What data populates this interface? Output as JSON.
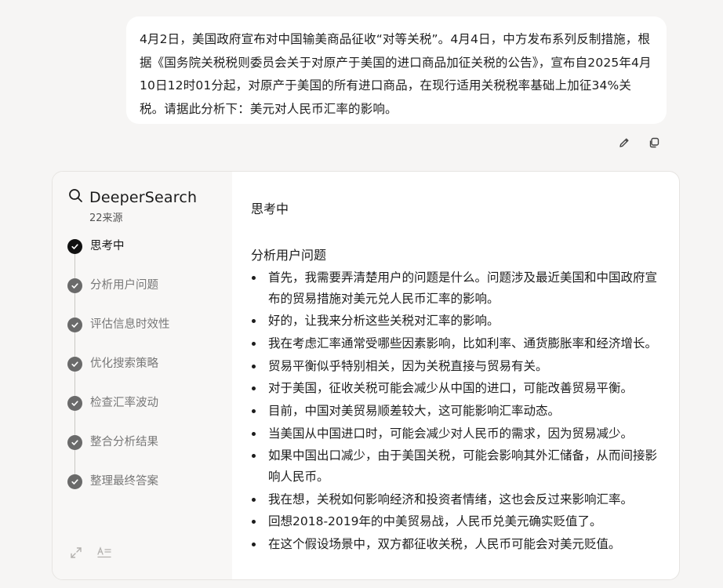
{
  "user_message": {
    "text": "4月2日，美国政府宣布对中国输美商品征收“对等关税”。4月4日，中方发布系列反制措施，根据《国务院关税税则委员会关于对原产于美国的进口商品加征关税的公告》，宣布自2025年4月10日12时01分起，对原产于美国的所有进口商品，在现行适用关税税率基础上加征34%关税。请据此分析下：美元对人民币汇率的影响。"
  },
  "message_actions": {
    "edit_icon": "pencil-icon",
    "copy_icon": "copy-icon"
  },
  "deepersearch": {
    "title": "DeeperSearch",
    "sources": "22来源",
    "steps": [
      {
        "label": "思考中",
        "status": "active"
      },
      {
        "label": "分析用户问题",
        "status": "done"
      },
      {
        "label": "评估信息时效性",
        "status": "done"
      },
      {
        "label": "优化搜索策略",
        "status": "done"
      },
      {
        "label": "检查汇率波动",
        "status": "done"
      },
      {
        "label": "整合分析结果",
        "status": "done"
      },
      {
        "label": "整理最终答案",
        "status": "done"
      }
    ],
    "tools": {
      "expand_icon": "expand-icon",
      "format_icon": "text-format-icon"
    }
  },
  "content": {
    "thinking_title": "思考中",
    "section_title": "分析用户问题",
    "bullets": [
      "首先，我需要弄清楚用户的问题是什么。问题涉及最近美国和中国政府宣布的贸易措施对美元兑人民币汇率的影响。",
      "好的，让我来分析这些关税对汇率的影响。",
      "我在考虑汇率通常受哪些因素影响，比如利率、通货膨胀率和经济增长。",
      "贸易平衡似乎特别相关，因为关税直接与贸易有关。",
      "对于美国，征收关税可能会减少从中国的进口，可能改善贸易平衡。",
      "目前，中国对美贸易顺差较大，这可能影响汇率动态。",
      "当美国从中国进口时，可能会减少对人民币的需求，因为贸易减少。",
      "如果中国出口减少，由于美国关税，可能会影响其外汇储备，从而间接影响人民币。",
      "我在想，关税如何影响经济和投资者情绪，这也会反过来影响汇率。",
      "回想2018-2019年的中美贸易战，人民币兑美元确实贬值了。",
      "在这个假设场景中，双方都征收关税，人民币可能会对美元贬值。"
    ]
  }
}
